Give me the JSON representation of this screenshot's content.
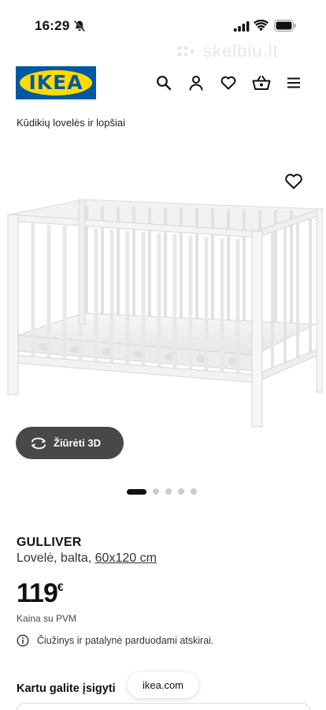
{
  "status_bar": {
    "time": "16:29"
  },
  "watermark": "skelbiu.lt",
  "header": {
    "logo_text": "IKEA"
  },
  "breadcrumb": "Kūdikių lovelės ir lopšiai",
  "view3d_label": "Žiūrėti 3D",
  "carousel": {
    "total": 5,
    "active": 1
  },
  "product": {
    "name": "GULLIVER",
    "description": "Lovelė, balta,",
    "size": "60x120 cm",
    "price": "119",
    "currency": "€",
    "vat_note": "Kaina su PVM",
    "notice": "Čiužinys ir patalynė parduodami atskirai."
  },
  "buy_with": "Kartu galite įsigyti",
  "browser_url": "ikea.com",
  "colors": {
    "ikea_blue": "#0058a3",
    "ikea_yellow": "#ffdb00"
  }
}
